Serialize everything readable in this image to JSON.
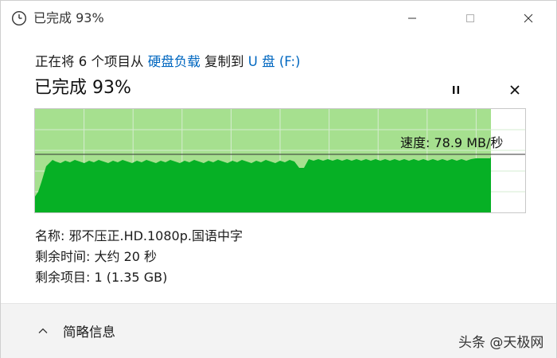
{
  "window": {
    "title": "已完成 93%",
    "minimize_icon": "minimize-icon",
    "maximize_icon": "maximize-icon",
    "close_icon": "close-icon"
  },
  "header": {
    "copy_prefix": "正在将 6 个项目从",
    "source": "硬盘负载",
    "copy_mid": "复制到",
    "destination": "U 盘 (F:)",
    "status": "已完成 93%",
    "pause_icon": "pause-icon",
    "cancel_icon": "cancel-icon"
  },
  "progress": {
    "percent": 93,
    "speed_label": "速度: 78.9 MB/秒",
    "colors": {
      "completed": "#a6e08f",
      "throughput": "#06b025",
      "line": "#333333",
      "grid": "#d6ecd0"
    }
  },
  "details": {
    "name_label": "名称: 邪不压正.HD.1080p.国语中字",
    "time_label": "剩余时间: 大约 20 秒",
    "items_label": "剩余项目: 1 (1.35 GB)"
  },
  "footer": {
    "toggle_label": "简略信息",
    "toggle_icon": "chevron-up-icon"
  },
  "watermark": "头条 @天极网"
}
